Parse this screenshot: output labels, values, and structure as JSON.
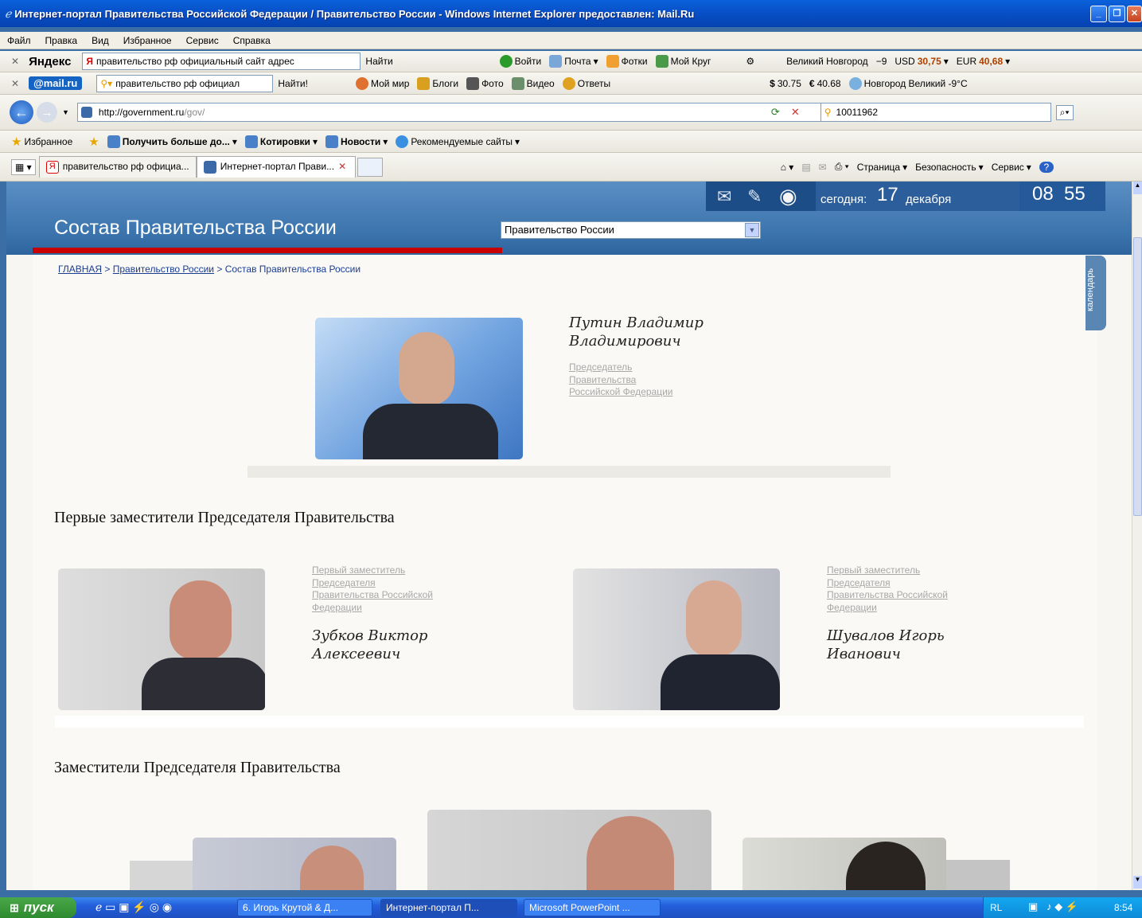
{
  "window": {
    "title": "Интернет-портал Правительства Российской Федерации / Правительство России - Windows Internet Explorer предоставлен: Mail.Ru"
  },
  "menu": [
    "Файл",
    "Правка",
    "Вид",
    "Избранное",
    "Сервис",
    "Справка"
  ],
  "yandex_bar": {
    "logo": "Яндекс",
    "search_value": "правительство рф официальный сайт адрес",
    "find": "Найти",
    "login": "Войти",
    "mail": "Почта",
    "photos": "Фотки",
    "my_circle": "Мой Круг",
    "city": "Великий Новгород",
    "temp": "−9",
    "usd_label": "USD",
    "usd": "30,75",
    "eur_label": "EUR",
    "eur": "40,68"
  },
  "mailru_bar": {
    "logo": "@mail.ru",
    "search_value": "правительство рф официал",
    "find": "Найти!",
    "my_world": "Мой мир",
    "blogs": "Блоги",
    "photo": "Фото",
    "video": "Видео",
    "answers": "Ответы",
    "usd": "30.75",
    "eur": "40.68",
    "weather": "Новгород Великий -9°C"
  },
  "address_bar": {
    "url_host": "http://government.ru",
    "url_path": "/gov/",
    "search_value": "10011962"
  },
  "favorites_bar": {
    "favorites": "Избранное",
    "items": [
      "Получить больше до...",
      "Котировки",
      "Новости",
      "Рекомендуемые сайты"
    ]
  },
  "tabs": {
    "items": [
      "правительство рф официа...",
      "Интернет-портал Прави..."
    ],
    "commands": [
      "Страница",
      "Безопасность",
      "Сервис"
    ]
  },
  "site": {
    "today_label": "сегодня:",
    "day": "17",
    "month": "декабря",
    "hour": "08",
    "minute": "55",
    "title": "Состав Правительства России",
    "select_value": "Правительство России",
    "calendar_tab": "календарь",
    "breadcrumb": {
      "home": "ГЛАВНАЯ",
      "sep": ">",
      "gov": "Правительство России",
      "current": "Состав Правительства России"
    },
    "chairman": {
      "name_line1": "Путин Владимир",
      "name_line2": "Владимирович",
      "pos_line1": "Председатель",
      "pos_line2": "Правительства",
      "pos_line3": "Российской Федерации"
    },
    "first_deputies_heading": "Первые заместители Председателя Правительства",
    "first_deputies": [
      {
        "pos_line1": "Первый заместитель",
        "pos_line2": "Председателя",
        "pos_line3": "Правительства Российской",
        "pos_line4": "Федерации",
        "name_line1": "Зубков Виктор",
        "name_line2": "Алексеевич"
      },
      {
        "pos_line1": "Первый заместитель",
        "pos_line2": "Председателя",
        "pos_line3": "Правительства Российской",
        "pos_line4": "Федерации",
        "name_line1": "Шувалов Игорь",
        "name_line2": "Иванович"
      }
    ],
    "deputies_heading": "Заместители Председателя Правительства"
  },
  "taskbar": {
    "start": "пуск",
    "tasks": [
      "6. Игорь Крутой & Д...",
      "Интернет-портал П...",
      "Microsoft PowerPoint ..."
    ],
    "lang": "RL",
    "time": "8:54"
  }
}
